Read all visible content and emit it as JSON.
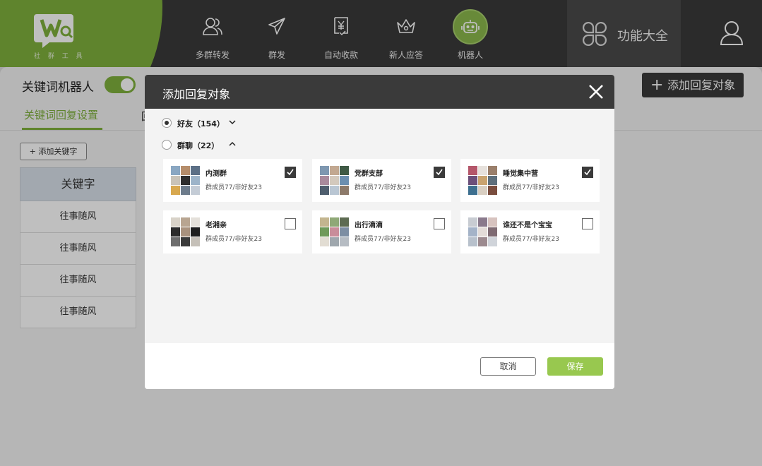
{
  "logo": {
    "text": "社 群 工 具"
  },
  "nav": [
    {
      "label": "多群转发",
      "icon": "users-icon"
    },
    {
      "label": "群发",
      "icon": "paper-plane-icon"
    },
    {
      "label": "自动收款",
      "icon": "yuan-receipt-icon"
    },
    {
      "label": "新人应答",
      "icon": "crown-icon"
    },
    {
      "label": "机器人",
      "icon": "robot-icon",
      "active": true
    }
  ],
  "function_all": {
    "label": "功能大全",
    "icon": "clover-grid-icon"
  },
  "user": {
    "icon": "user-icon"
  },
  "page": {
    "title": "关键词机器人",
    "toggle_on": true,
    "tab_active": "关键词回复设置",
    "tab_other": "回",
    "add_keyword": "+ 添加关键字",
    "add_reply_object": "添加回复对象",
    "table_header": "关键字",
    "rows": [
      "往事随风",
      "往事随风",
      "往事随风",
      "往事随风"
    ]
  },
  "modal": {
    "title": "添加回复对象",
    "friends": {
      "label": "好友（154）",
      "selected": true,
      "expanded": false
    },
    "groups": {
      "label": "群聊（22）",
      "selected": false,
      "expanded": true
    },
    "cards": [
      {
        "name": "内测群",
        "meta": "群成员77/非好友23",
        "checked": true
      },
      {
        "name": "党群支部",
        "meta": "群成员77/非好友23",
        "checked": true
      },
      {
        "name": "睡觉集中营",
        "meta": "群成员77/非好友23",
        "checked": true
      },
      {
        "name": "老湘亲",
        "meta": "群成员77/非好友23",
        "checked": false
      },
      {
        "name": "出行滴滴",
        "meta": "群成员77/非好友23",
        "checked": false
      },
      {
        "name": "谁还不是个宝宝",
        "meta": "群成员77/非好友23",
        "checked": false
      }
    ],
    "cancel": "取消",
    "save": "保存"
  },
  "colors": {
    "accent": "#7fb13d",
    "dark": "#3a3a3a",
    "save": "#98c84f"
  }
}
